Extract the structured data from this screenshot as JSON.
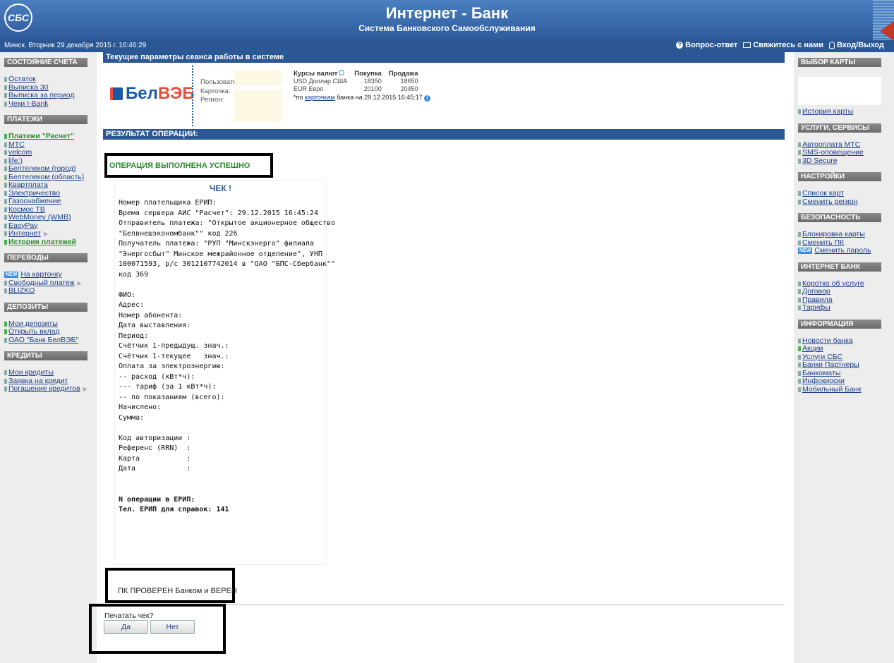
{
  "header": {
    "logo": "СБС",
    "title": "Интернет - Банк",
    "subtitle": "Система Банковского Самообслуживания"
  },
  "topbar": {
    "datetime": "Минск. Вторник 29 декабря 2015 г. 16:46:29",
    "faq": "Вопрос-ответ",
    "contact": "Свяжитесь с нами",
    "login": "Вход/Выход"
  },
  "left_sidebar": {
    "sections": [
      {
        "title": "СОСТОЯНИЕ СЧЕТА",
        "items": [
          "Остаток",
          "Выписка 30",
          "Выписка за период",
          "Чеки I-Bank"
        ]
      },
      {
        "title": "ПЛАТЕЖИ",
        "items": [
          "Платежи \"Расчет\"",
          "МТС",
          "velcom",
          "life:)",
          "Белтелеком (город)",
          "Белтелеком (область)",
          "Квартплата",
          "Электричество",
          "Газоснабжение",
          "Космос ТВ",
          "WebMoney (WMB)",
          "EasyPay",
          "Интернет",
          "История платежей"
        ]
      },
      {
        "title": "ПЕРЕВОДЫ",
        "items": [
          "На карточку",
          "Свободный платеж",
          "BLIZKO"
        ]
      },
      {
        "title": "ДЕПОЗИТЫ",
        "items": [
          "Мои депозиты",
          "Открыть вклад",
          "ОАО \"Банк БелВЭБ\""
        ]
      },
      {
        "title": "КРЕДИТЫ",
        "items": [
          "Мои кредиты",
          "Заявка на кредит",
          "Погашение кредитов"
        ]
      }
    ],
    "new_badge": "NEW"
  },
  "right_sidebar": {
    "sections": [
      {
        "title": "ВЫБОР КАРТЫ",
        "items": [
          "История карты"
        ]
      },
      {
        "title": "УСЛУГИ, СЕРВИСЫ",
        "items": [
          "Автооплата МТС",
          "SMS-оповещение",
          "3D Secure"
        ]
      },
      {
        "title": "НАСТРОЙКИ",
        "items": [
          "Список карт",
          "Сменить регион"
        ]
      },
      {
        "title": "БЕЗОПАСНОСТЬ",
        "items": [
          "Блокировка карты",
          "Сменить ПК",
          "Сменить пароль"
        ]
      },
      {
        "title": "ИНТЕРНЕТ БАНК",
        "items": [
          "Коротко об услуге",
          "Договор",
          "Правила",
          "Тарифы"
        ]
      },
      {
        "title": "ИНФОРМАЦИЯ",
        "items": [
          "Новости банка",
          "Акции",
          "Услуги СБС",
          "Банки Партнеры",
          "Банкоматы",
          "Инфокиоски",
          "Мобильный Банк"
        ]
      }
    ]
  },
  "session": {
    "bar_title": "Текущие параметры сеанса работы в системе",
    "bank_logo_part1": "Бел",
    "bank_logo_part2": "ВЭБ",
    "labels": [
      "Пользователь",
      "Карточка:",
      "Регион:"
    ],
    "rates": {
      "header": [
        "Курсы валют",
        "Покупка",
        "Продажа"
      ],
      "rows": [
        [
          "USD  Доллар США",
          "18350",
          "18650"
        ],
        [
          "EUR  Евро",
          "20100",
          "20450"
        ]
      ],
      "note_prefix": "*по ",
      "note_link": "карточкам",
      "note_suffix": " банка на 29.12.2015 16:45:17"
    }
  },
  "result": {
    "bar_title": "РЕЗУЛЬТАТ ОПЕРАЦИИ:",
    "success": "ОПЕРАЦИЯ ВЫПОЛНЕНА УСПЕШНО",
    "receipt_title": "ЧЕК !",
    "receipt_lines": [
      "Номер плательщика ЕРИП:",
      "Время сервера АИС \"Расчет\": 29.12.2015 16:45:24",
      "Отправитель платежа: \"Открытое акционерное общество",
      "\"Белвнешэкономбанк\"\" код 226",
      "Получатель платежа: \"РУП \"Минскэнерго\" филиала",
      "\"Энергосбыт\" Минское межрайонное отделение\", УНП",
      "100071593, р/с 3012107742014 в \"ОАО \"БПС-Сбербанк\"\"",
      "код 369",
      "",
      "ФИО:",
      "Адрес:",
      "Номер абонента:",
      "Дата выставления:",
      "Период:",
      "Счётчик 1-предыдущ. знач.:",
      "Счётчик 1-текущее   знач.:",
      "Оплата за электроэнергию:",
      "-- расход (кВт*ч):",
      "--- тариф (за 1 кВт*ч):",
      "-- по показаниям (всего):",
      "Начислено:",
      "Сумма:",
      "",
      "Код авторизации :",
      "Референс (RRN)  :",
      "Карта           :",
      "Дата            :",
      "",
      "",
      "N операции в ЕРИП:",
      "Тел. ЕРИП для справок: 141"
    ],
    "check_status": "ПК ПРОВЕРЕН Банком и ВЕРЕН",
    "print_question": "Печатать чек?",
    "yes": "Да",
    "no": "Нет"
  }
}
